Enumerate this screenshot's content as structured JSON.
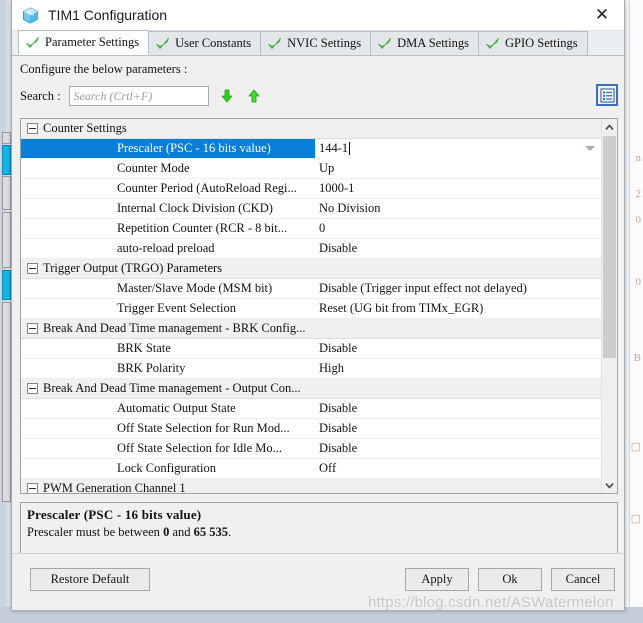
{
  "window": {
    "title": "TIM1 Configuration",
    "icon": "cube-icon",
    "close_label": "✕"
  },
  "tabs": [
    {
      "label": "Parameter Settings",
      "active": true,
      "icon": "green-check-icon"
    },
    {
      "label": "User Constants",
      "active": false,
      "icon": "green-check-icon"
    },
    {
      "label": "NVIC Settings",
      "active": false,
      "icon": "green-check-icon"
    },
    {
      "label": "DMA Settings",
      "active": false,
      "icon": "green-check-icon"
    },
    {
      "label": "GPIO Settings",
      "active": false,
      "icon": "green-check-icon"
    }
  ],
  "instruction": "Configure the below parameters :",
  "search": {
    "label": "Search :",
    "value": "",
    "placeholder": "Search (Crtl+F)",
    "down_icon": "search-next-down-icon",
    "up_icon": "search-prev-up-icon",
    "list_toggle_icon": "list-view-icon"
  },
  "parameters": {
    "groups": [
      {
        "name": "Counter Settings",
        "expanded": true,
        "rows": [
          {
            "name": "Prescaler (PSC - 16 bits value)",
            "value": "144-1",
            "selected": true,
            "editing": true,
            "has_dropdown": true
          },
          {
            "name": "Counter Mode",
            "value": "Up",
            "selected": false
          },
          {
            "name": "Counter Period (AutoReload Regi...",
            "value": "1000-1",
            "selected": false
          },
          {
            "name": "Internal Clock Division (CKD)",
            "value": "No Division",
            "selected": false
          },
          {
            "name": "Repetition Counter (RCR - 8 bit...",
            "value": "0",
            "selected": false
          },
          {
            "name": "auto-reload preload",
            "value": "Disable",
            "selected": false
          }
        ]
      },
      {
        "name": "Trigger Output (TRGO) Parameters",
        "expanded": true,
        "rows": [
          {
            "name": "Master/Slave Mode (MSM bit)",
            "value": "Disable (Trigger input effect not delayed)",
            "selected": false
          },
          {
            "name": "Trigger Event Selection",
            "value": "Reset (UG bit from TIMx_EGR)",
            "selected": false
          }
        ]
      },
      {
        "name": "Break And Dead Time management - BRK Config...",
        "expanded": true,
        "rows": [
          {
            "name": "BRK State",
            "value": "Disable",
            "selected": false
          },
          {
            "name": "BRK Polarity",
            "value": "High",
            "selected": false
          }
        ]
      },
      {
        "name": "Break And Dead Time management - Output Con...",
        "expanded": true,
        "rows": [
          {
            "name": "Automatic Output State",
            "value": "Disable",
            "selected": false
          },
          {
            "name": "Off State Selection for Run Mod...",
            "value": "Disable",
            "selected": false
          },
          {
            "name": "Off State Selection for Idle Mo...",
            "value": "Disable",
            "selected": false
          },
          {
            "name": "Lock Configuration",
            "value": "Off",
            "selected": false
          }
        ]
      },
      {
        "name": "PWM Generation Channel 1",
        "expanded": true,
        "rows": []
      }
    ]
  },
  "description": {
    "title": "Prescaler (PSC - 16 bits value)",
    "text_1": "Prescaler must be between ",
    "bold_1": "0",
    "text_2": " and ",
    "bold_2": "65 535",
    "text_3": "."
  },
  "buttons": {
    "restore": "Restore Default",
    "apply": "Apply",
    "ok": "Ok",
    "cancel": "Cancel"
  },
  "watermark": "https://blog.csdn.net/ASWatermelon",
  "colors": {
    "selection": "#0a7fd9",
    "accent_blue": "#3a6fc4",
    "check_green": "#4cc94c",
    "arrow_green": "#33cc22"
  }
}
